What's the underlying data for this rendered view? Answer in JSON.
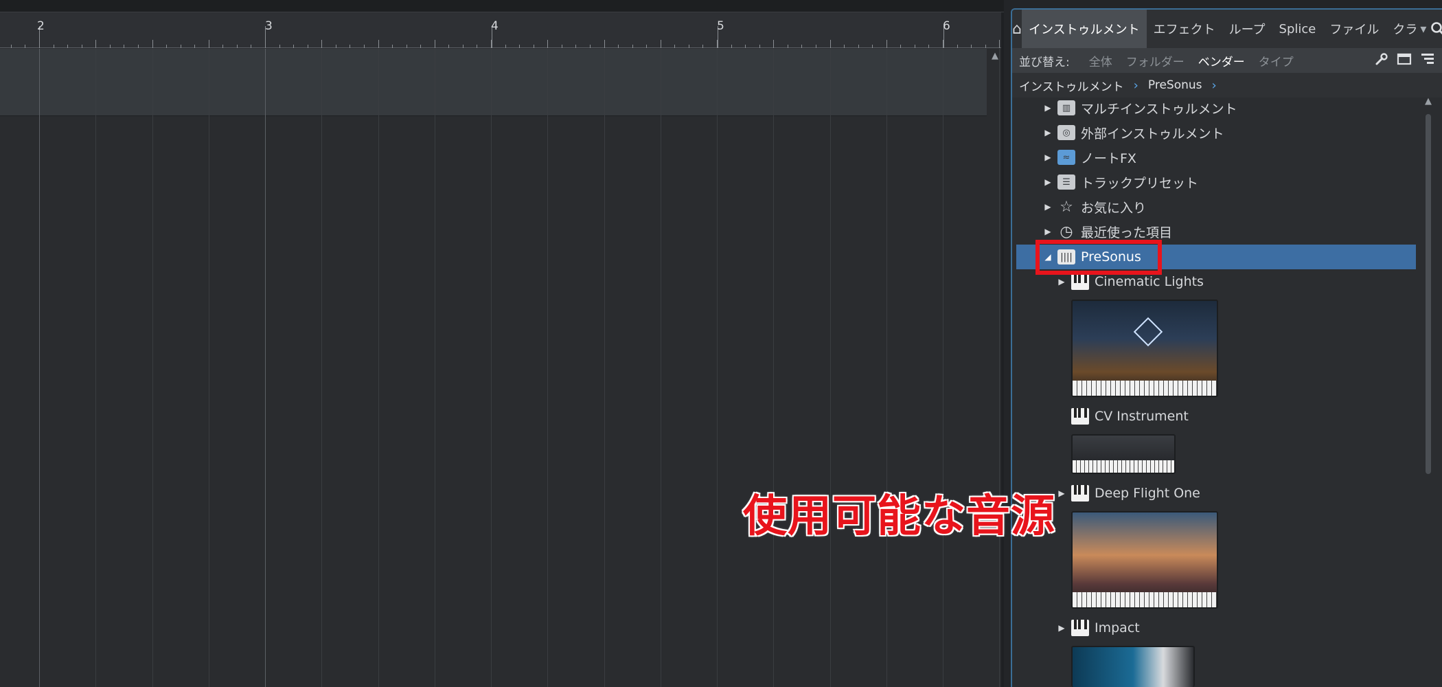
{
  "timeline": {
    "bar_numbers": [
      "2",
      "3",
      "4",
      "5",
      "6"
    ]
  },
  "browser": {
    "tabs": [
      {
        "label": "インストゥルメント",
        "active": true
      },
      {
        "label": "エフェクト",
        "active": false
      },
      {
        "label": "ループ",
        "active": false
      },
      {
        "label": "Splice",
        "active": false
      },
      {
        "label": "ファイル",
        "active": false
      },
      {
        "label": "クラ",
        "active": false
      }
    ],
    "sort": {
      "label": "並び替え:",
      "options": [
        {
          "label": "全体",
          "active": false
        },
        {
          "label": "フォルダー",
          "active": false
        },
        {
          "label": "ベンダー",
          "active": true
        },
        {
          "label": "タイプ",
          "active": false
        }
      ]
    },
    "breadcrumb": [
      "インストゥルメント",
      "PreSonus"
    ],
    "items": [
      {
        "label": "マルチインストゥルメント",
        "icon": "multi-instrument-folder-icon",
        "expanded": false,
        "level": 0
      },
      {
        "label": "外部インストゥルメント",
        "icon": "external-instrument-folder-icon",
        "expanded": false,
        "level": 0
      },
      {
        "label": "ノートFX",
        "icon": "notefx-folder-icon",
        "expanded": false,
        "level": 0
      },
      {
        "label": "トラックプリセット",
        "icon": "track-preset-folder-icon",
        "expanded": false,
        "level": 0
      },
      {
        "label": "お気に入り",
        "icon": "star-icon",
        "expanded": false,
        "level": 0
      },
      {
        "label": "最近使った項目",
        "icon": "clock-icon",
        "expanded": false,
        "level": 0
      },
      {
        "label": "PreSonus",
        "icon": "presonus-logo-icon",
        "expanded": true,
        "selected": true,
        "level": 0
      },
      {
        "label": "Cinematic Lights",
        "icon": "piano-icon",
        "expanded": false,
        "level": 1
      },
      {
        "label": "CV Instrument",
        "icon": "piano-icon",
        "expanded": false,
        "level": 1
      },
      {
        "label": "Deep Flight One",
        "icon": "piano-icon",
        "expanded": false,
        "level": 1
      },
      {
        "label": "Impact",
        "icon": "piano-icon",
        "expanded": false,
        "level": 1
      }
    ]
  },
  "annotation": {
    "text": "使用可能な音源",
    "color": "#e8141c"
  },
  "colors": {
    "accent": "#3d6ea3",
    "panel_border": "#3b6e96",
    "highlight": "#e8141c"
  }
}
